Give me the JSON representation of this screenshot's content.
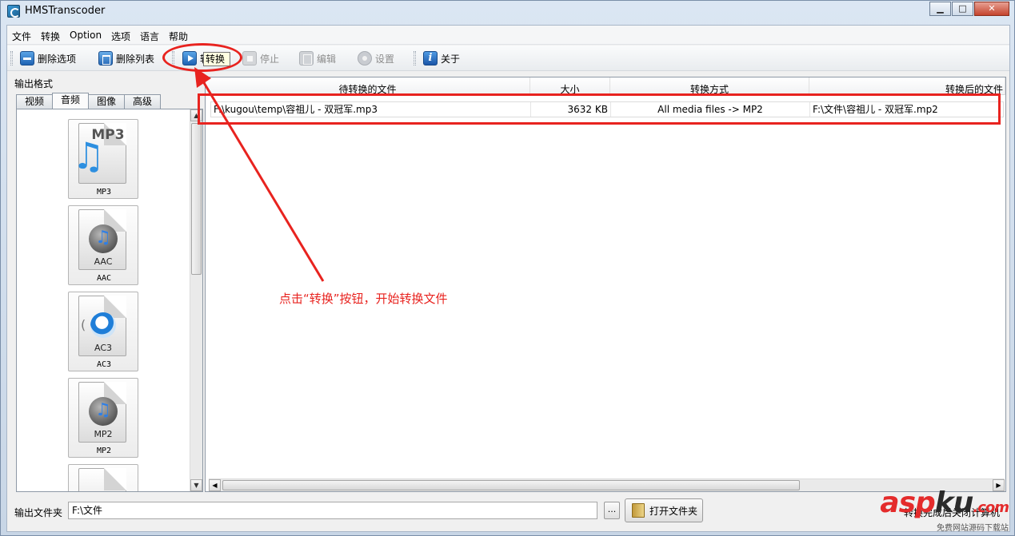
{
  "window": {
    "title": "HMSTranscoder",
    "min": "▁",
    "max": "□",
    "close": "✕"
  },
  "menu": [
    "文件",
    "转换",
    "Option",
    "选项",
    "语言",
    "帮助"
  ],
  "toolbar": {
    "delete_item": "删除选项",
    "delete_list": "删除列表",
    "convert": "转换",
    "stop": "停止",
    "edit": "编辑",
    "settings": "设置",
    "about": "关于",
    "tooltip": "转换"
  },
  "left": {
    "output_format_label": "输出格式",
    "tabs": [
      "视频",
      "音频",
      "图像",
      "高级"
    ],
    "active_tab": 1,
    "formats": [
      {
        "label": "MP3",
        "icon_text": "MP3"
      },
      {
        "label": "AAC",
        "icon_text": "AAC"
      },
      {
        "label": "AC3",
        "icon_text": "AC3"
      },
      {
        "label": "MP2",
        "icon_text": "MP2"
      }
    ]
  },
  "table": {
    "columns": [
      "待转换的文件",
      "大小",
      "转换方式",
      "转换后的文件"
    ],
    "rows": [
      {
        "source": "F:\\kugou\\temp\\容祖儿 - 双冠军.mp3",
        "size": "3632 KB",
        "method": "All media files -> MP2",
        "target": "F:\\文件\\容祖儿 - 双冠军.mp2"
      }
    ]
  },
  "bottom": {
    "output_folder_label": "输出文件夹",
    "output_folder_value": "F:\\文件",
    "browse": "...",
    "open_folder": "打开文件夹",
    "shutdown": "转换完成后关闭计算机"
  },
  "annotation": {
    "text": "点击“转换”按钮，开始转换文件",
    "color": "#e8231f"
  },
  "watermark": {
    "asp": "asp",
    "ku": "ku",
    "com": ".com",
    "sub": "免费网站源码下载站"
  }
}
